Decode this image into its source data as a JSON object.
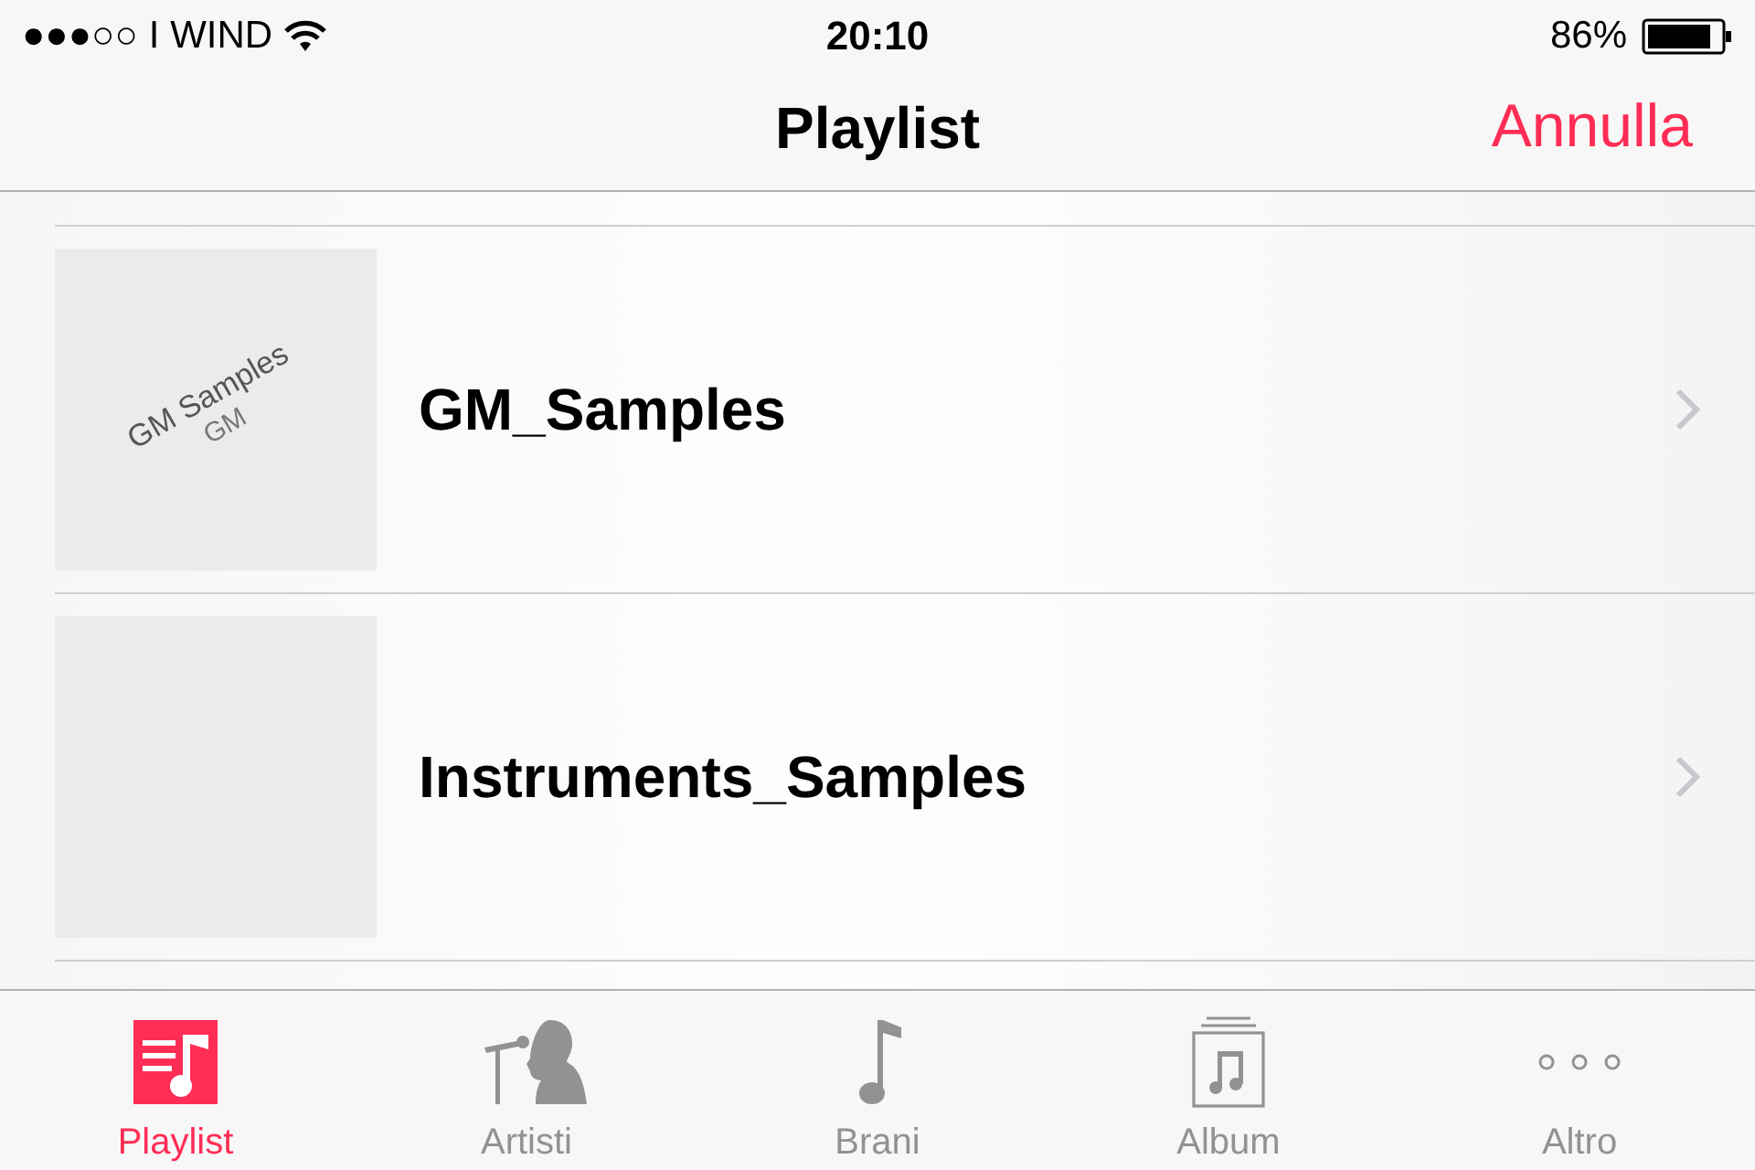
{
  "status_bar": {
    "signal_bars": "●●●○○",
    "carrier": "I WIND",
    "time": "20:10",
    "battery": "86%"
  },
  "nav_bar": {
    "title": "Playlist",
    "action": "Annulla"
  },
  "playlists": [
    {
      "title": "GM_Samples",
      "artwork_lines": [
        "GM Samples",
        "GM"
      ]
    },
    {
      "title": "Instruments_Samples"
    }
  ],
  "tabs": [
    {
      "kind": "playlist",
      "label": "Playlist",
      "selected": true
    },
    {
      "kind": "artist",
      "label": "Artisti",
      "selected": false
    },
    {
      "kind": "song",
      "label": "Brani",
      "selected": false
    },
    {
      "kind": "album",
      "label": "Album",
      "selected": false
    },
    {
      "kind": "more",
      "label": "Altro",
      "selected": false
    }
  ]
}
